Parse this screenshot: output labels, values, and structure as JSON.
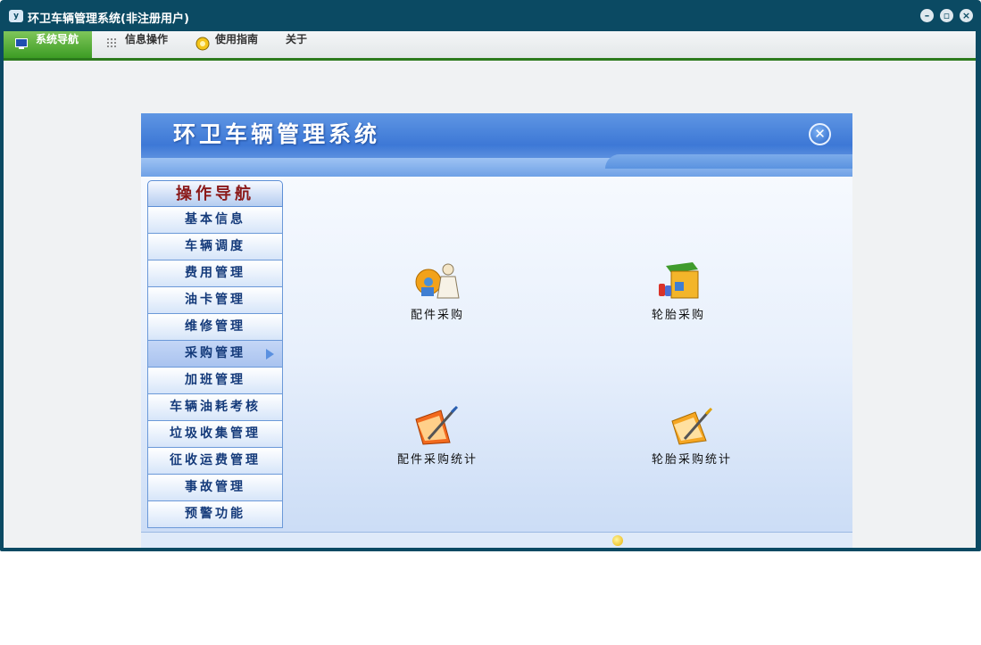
{
  "window": {
    "title": "环卫车辆管理系统(非注册用户)",
    "app_icon_text": "y",
    "buttons": [
      "minimize",
      "restore",
      "close"
    ]
  },
  "menu": {
    "items": [
      {
        "label": "系统导航",
        "icon": "monitor-icon",
        "active": true
      },
      {
        "label": "信息操作",
        "icon": "grid-icon",
        "active": false
      },
      {
        "label": "使用指南",
        "icon": "help-circle-icon",
        "active": false
      },
      {
        "label": "关于",
        "icon": "",
        "active": false
      }
    ]
  },
  "banner": {
    "title": "环卫车辆管理系统",
    "close_icon": "close-circle-icon"
  },
  "nav": {
    "header": "操作导航",
    "items": [
      {
        "label": "基本信息"
      },
      {
        "label": "车辆调度"
      },
      {
        "label": "费用管理"
      },
      {
        "label": "油卡管理"
      },
      {
        "label": "维修管理"
      },
      {
        "label": "采购管理",
        "selected": true
      },
      {
        "label": "加班管理"
      },
      {
        "label": "车辆油耗考核"
      },
      {
        "label": "垃圾收集管理"
      },
      {
        "label": "征收运费管理"
      },
      {
        "label": "事故管理"
      },
      {
        "label": "预警功能"
      }
    ]
  },
  "tiles": [
    {
      "label": "配件采购",
      "icon": "parts-purchase-icon"
    },
    {
      "label": "轮胎采购",
      "icon": "tire-purchase-icon"
    },
    {
      "label": "配件采购统计",
      "icon": "parts-stats-icon"
    },
    {
      "label": "轮胎采购统计",
      "icon": "tire-stats-icon"
    }
  ],
  "colors": {
    "titlebar": "#0b4a63",
    "menu_active": "#3c9c24",
    "nav_text": "#143a7a",
    "nav_header_text": "#8b1a1a"
  }
}
